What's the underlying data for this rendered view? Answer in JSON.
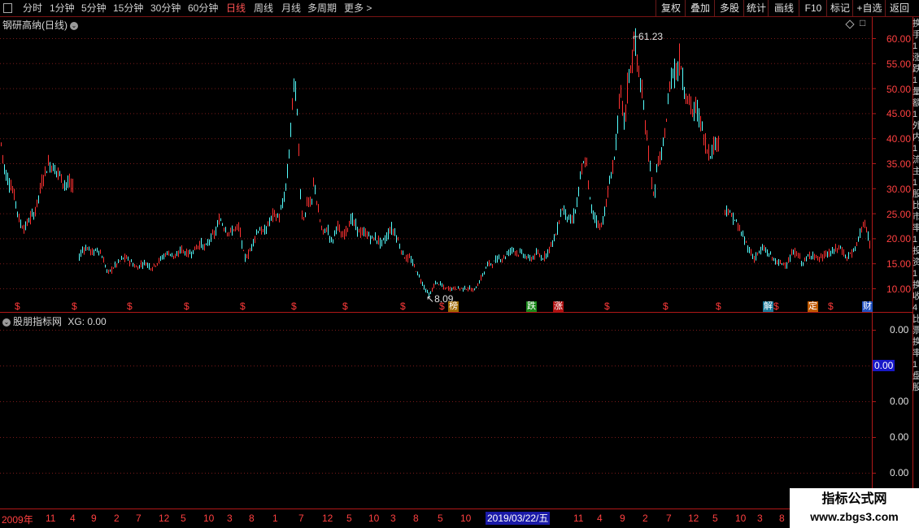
{
  "toolbar": {
    "periods": [
      "分时",
      "1分钟",
      "5分钟",
      "15分钟",
      "30分钟",
      "60分钟",
      "日线",
      "周线",
      "月线",
      "多周期",
      "更多 >"
    ],
    "active_period": "日线",
    "actions": [
      "复权",
      "叠加",
      "多股",
      "统计",
      "画线",
      "F10",
      "标记",
      "+自选",
      "返回"
    ]
  },
  "main_chart": {
    "title": "钢研高纳(日线)",
    "y_ticks": [
      "60.00",
      "55.00",
      "50.00",
      "45.00",
      "40.00",
      "35.00",
      "30.00",
      "25.00",
      "20.00",
      "15.00",
      "10.00"
    ],
    "high_label": "61.23",
    "low_label": "8.09",
    "up_color": "#ff3232",
    "down_color": "#54ffff",
    "marker_glyph": "$",
    "badges": [
      {
        "text": "榜",
        "color": "#a06a00"
      },
      {
        "text": "跌",
        "color": "#1a8a1a"
      },
      {
        "text": "涨",
        "color": "#b01010"
      },
      {
        "text": "解",
        "color": "#1a7a9a"
      },
      {
        "text": "定",
        "color": "#c05a00"
      },
      {
        "text": "财",
        "color": "#2050c0"
      }
    ]
  },
  "indicator": {
    "title": "股朋指标网",
    "series_label": "XG: 0.00",
    "y_ticks": [
      "0.00",
      "0.00",
      "0.00",
      "0.00"
    ],
    "current_value": "0.00"
  },
  "date_axis": {
    "labels": [
      "2009年",
      "11",
      "4",
      "9",
      "2",
      "7",
      "12",
      "5",
      "10",
      "3",
      "8",
      "1",
      "7",
      "12",
      "5",
      "10",
      "3",
      "8",
      "5",
      "10",
      "11",
      "4",
      "9",
      "2",
      "7",
      "12",
      "5",
      "10",
      "3",
      "8"
    ],
    "cursor_date": "2019/03/22/五"
  },
  "watermark": {
    "title": "指标公式网",
    "url": "www.zbgs3.com"
  },
  "right_panel_fragment": [
    "换",
    "手",
    "1",
    "涨",
    "跌",
    "1",
    "量",
    "额",
    "1",
    "外",
    "内",
    "1",
    "流",
    "主",
    "1",
    "股",
    "比",
    "市",
    "率",
    "1",
    "投",
    "资",
    "1",
    "换",
    "收",
    "4",
    "比",
    "票",
    "换",
    "率",
    "1",
    "盘",
    "股"
  ]
}
